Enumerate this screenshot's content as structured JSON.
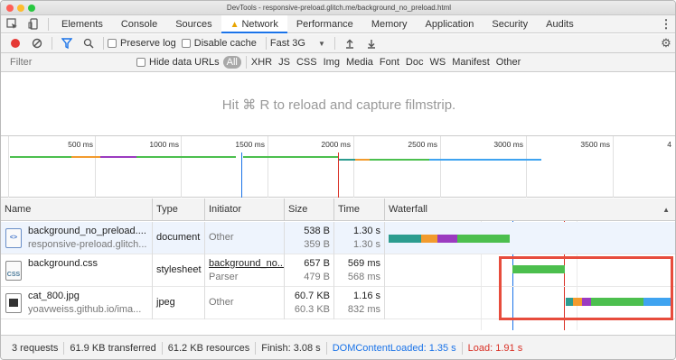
{
  "titlebar": {
    "title": "DevTools - responsive-preload.glitch.me/background_no_preload.html"
  },
  "tabs": [
    {
      "label": "Elements",
      "active": false
    },
    {
      "label": "Console",
      "active": false
    },
    {
      "label": "Sources",
      "active": false
    },
    {
      "label": "Network",
      "active": true,
      "warning": true
    },
    {
      "label": "Performance",
      "active": false
    },
    {
      "label": "Memory",
      "active": false
    },
    {
      "label": "Application",
      "active": false
    },
    {
      "label": "Security",
      "active": false
    },
    {
      "label": "Audits",
      "active": false
    }
  ],
  "toolbar": {
    "preserve_log": "Preserve log",
    "disable_cache": "Disable cache",
    "throttle": "Fast 3G"
  },
  "filter": {
    "placeholder": "Filter",
    "hide_data_urls": "Hide data URLs",
    "types": [
      "All",
      "XHR",
      "JS",
      "CSS",
      "Img",
      "Media",
      "Font",
      "Doc",
      "WS",
      "Manifest",
      "Other"
    ]
  },
  "filmstrip": {
    "message": "Hit ⌘ R to reload and capture filmstrip."
  },
  "overview": {
    "ticks": [
      "500 ms",
      "1000 ms",
      "1500 ms",
      "2000 ms",
      "2500 ms",
      "3000 ms",
      "3500 ms",
      "4"
    ]
  },
  "columns": [
    "Name",
    "Type",
    "Initiator",
    "Size",
    "Time",
    "Waterfall"
  ],
  "requests": [
    {
      "name": "background_no_preload....",
      "path": "responsive-preload.glitch...",
      "icon": "html-doc-icon",
      "type": "document",
      "initiator": "Other",
      "initiator_sub": "",
      "size": "538 B",
      "size_sub": "359 B",
      "time": "1.30 s",
      "time_sub": "1.30 s"
    },
    {
      "name": "background.css",
      "path": "",
      "icon": "css-file-icon",
      "type": "stylesheet",
      "initiator": "background_no...",
      "initiator_sub": "Parser",
      "size": "657 B",
      "size_sub": "479 B",
      "time": "569 ms",
      "time_sub": "568 ms"
    },
    {
      "name": "cat_800.jpg",
      "path": "yoavweiss.github.io/ima...",
      "icon": "image-file-icon",
      "type": "jpeg",
      "initiator": "Other",
      "initiator_sub": "",
      "size": "60.7 KB",
      "size_sub": "60.3 KB",
      "time": "1.16 s",
      "time_sub": "832 ms"
    }
  ],
  "status": {
    "requests": "3 requests",
    "transferred": "61.9 KB transferred",
    "resources": "61.2 KB resources",
    "finish": "Finish: 3.08 s",
    "dcl": "DOMContentLoaded: 1.35 s",
    "load": "Load: 1.91 s"
  },
  "colors": {
    "accent": "#1a73e8",
    "dcl": "#1a73e8",
    "load": "#d93025",
    "highlight": "#e74c3c",
    "waiting_green": "#4cbf4e",
    "download_blue": "#3fa3f0",
    "ssl_purple": "#9b3bc0",
    "connect_orange": "#f29b2e",
    "dns_teal": "#2c9c8f"
  }
}
